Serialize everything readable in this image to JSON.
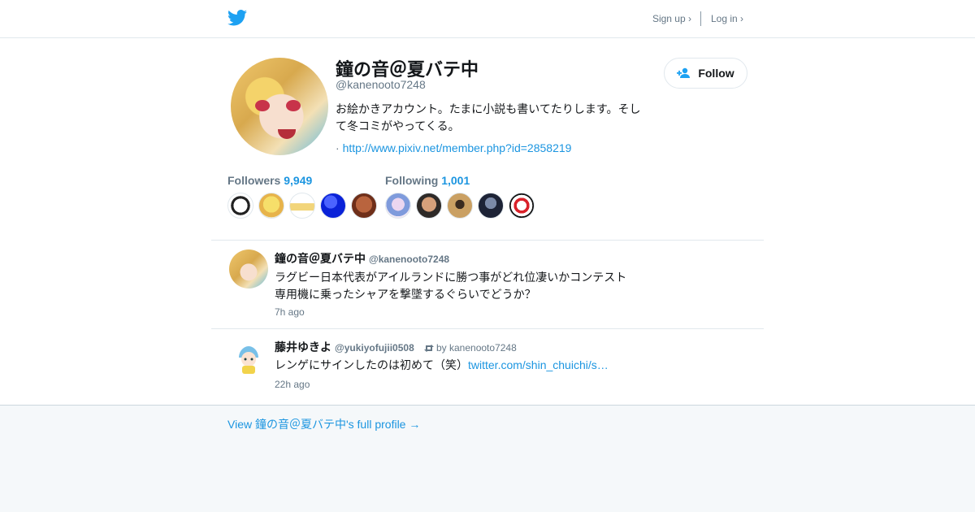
{
  "header": {
    "logo": "twitter-bird-icon",
    "sign_up": "Sign up ›",
    "log_in": "Log in ›",
    "brand_color": "#1da1f2"
  },
  "profile": {
    "name": "鐘の音＠夏バテ中",
    "handle": "@kanenooto7248",
    "bio": "お絵かきアカウント。たまに小説も書いてたりします。そして冬コミがやってくる。",
    "link_prefix": "·",
    "link": "http://www.pixiv.net/member.php?id=2858219",
    "follow_label": "Follow"
  },
  "stats": {
    "followers_label": "Followers",
    "followers_count": "9,949",
    "following_label": "Following",
    "following_count": "1,001"
  },
  "tweets": [
    {
      "name": "鐘の音＠夏バテ中",
      "handle": "@kanenooto7248",
      "text_line1": "ラグビー日本代表がアイルランドに勝つ事がどれ位凄いかコンテスト",
      "text_line2": "専用機に乗ったシャアを撃墜するぐらいでどうか？",
      "time": "7h ago"
    },
    {
      "name": "藤井ゆきよ",
      "handle": "@yukiyofujii0508",
      "retweet_by": "by kanenooto7248",
      "text": "レンゲにサインしたのは初めて（笑）",
      "link": "twitter.com/shin_chuichi/s…",
      "time": "22h ago"
    }
  ],
  "footer": {
    "full_profile": "View 鐘の音＠夏バテ中's full profile →"
  }
}
